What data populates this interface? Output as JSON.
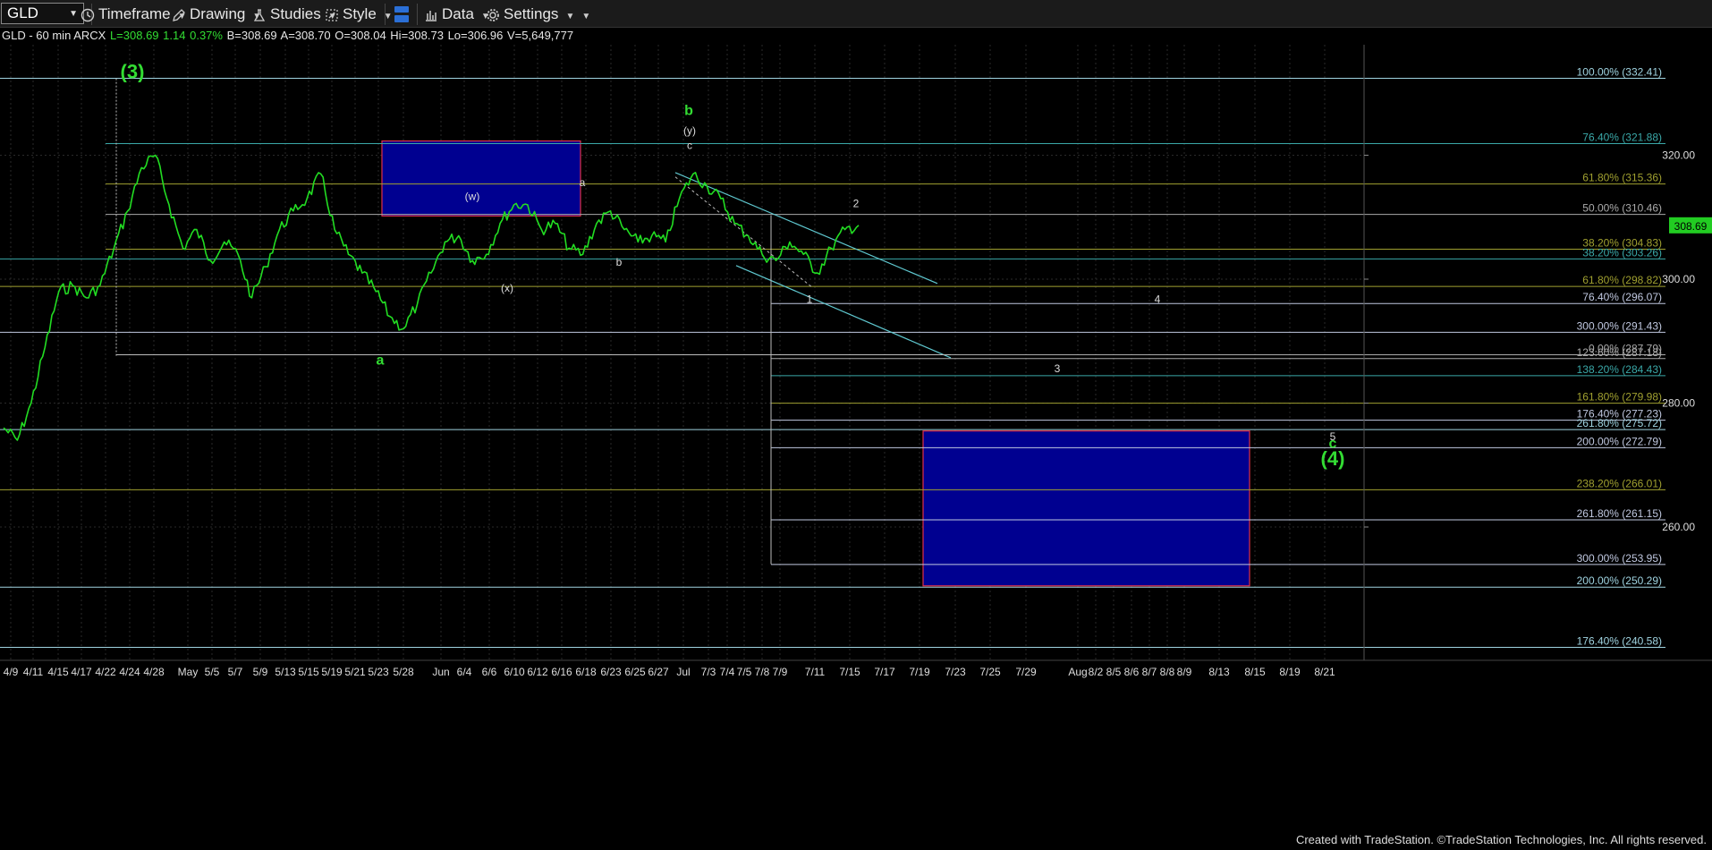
{
  "toolbar": {
    "symbol": "GLD",
    "timeframe": "Timeframe",
    "drawing": "Drawing",
    "studies": "Studies",
    "style": "Style",
    "data": "Data",
    "settings": "Settings"
  },
  "quote": {
    "title": "GLD - 60 min ARCX",
    "last": "L=308.69",
    "change": "1.14",
    "pct": "0.37%",
    "bid": "B=308.69",
    "ask": "A=308.70",
    "open": "O=308.04",
    "high": "Hi=308.73",
    "low": "Lo=306.96",
    "volume": "V=5,649,777"
  },
  "credit": "Created with TradeStation. ©TradeStation Technologies, Inc. All rights reserved.",
  "colors": {
    "background": "#000000",
    "price": "#22dd22",
    "box_fill": "#000090",
    "box_border": "#e0304a",
    "wave_green": "#33dd33",
    "wave_white": "#dddddd",
    "last_price_tag": "#22cc22"
  },
  "chart_data": {
    "type": "line",
    "series": [
      {
        "values": [
          276,
          274,
          280,
          289,
          298,
          299,
          297,
          299,
          305,
          311,
          318,
          320,
          312,
          305,
          308,
          303,
          306,
          304,
          297,
          302,
          308,
          311,
          313,
          317,
          308,
          304,
          301,
          298,
          294,
          292,
          296,
          301,
          306,
          307,
          303,
          304,
          309,
          312,
          312,
          308,
          309,
          305,
          304,
          309,
          311,
          308,
          306,
          307,
          306,
          313,
          317,
          315,
          313,
          309,
          307,
          304,
          303,
          306,
          304,
          301,
          305,
          308,
          308.69
        ]
      }
    ],
    "y_ticks": [
      "320.00",
      "300.00",
      "280.00",
      "260.00"
    ],
    "ylim": [
      237,
      345
    ],
    "x_ticks": [
      "4/9",
      "4/11",
      "4/15",
      "4/17",
      "4/22",
      "4/24",
      "4/28",
      "May",
      "5/5",
      "5/7",
      "5/9",
      "5/13",
      "5/15",
      "5/19",
      "5/21",
      "5/23",
      "5/28",
      "Jun",
      "6/4",
      "6/6",
      "6/10",
      "6/12",
      "6/16",
      "6/18",
      "6/23",
      "6/25",
      "6/27",
      "Jul",
      "7/3",
      "7/4",
      "7/5",
      "7/8",
      "7/9",
      "7/11",
      "7/15",
      "7/17",
      "7/19",
      "7/23",
      "7/25",
      "7/29",
      "Aug",
      "8/2",
      "8/5",
      "8/6",
      "8/7",
      "8/8",
      "8/9",
      "8/13",
      "8/15",
      "8/19",
      "8/21"
    ],
    "last_price": "308.69",
    "fib_levels": [
      {
        "label": "100.00% (332.41)",
        "value": 332.41,
        "color": "#9fd3e0"
      },
      {
        "label": "76.40% (321.88)",
        "value": 321.88,
        "color": "#3aa8a8"
      },
      {
        "label": "61.80% (315.36)",
        "value": 315.36,
        "color": "#a0a030"
      },
      {
        "label": "50.00% (310.46)",
        "value": 310.46,
        "color": "#aaaaaa"
      },
      {
        "label": "38.20% (304.83)",
        "value": 304.83,
        "color": "#a0a030"
      },
      {
        "label": "38.20% (303.26)",
        "value": 303.26,
        "color": "#3aa8a8"
      },
      {
        "label": "61.80% (298.82)",
        "value": 298.82,
        "color": "#a0a030"
      },
      {
        "label": "76.40% (296.07)",
        "value": 296.07,
        "color": "#c0c8e0"
      },
      {
        "label": "300.00% (291.43)",
        "value": 291.43,
        "color": "#c0c8e0"
      },
      {
        "label": "0.00% (287.79)",
        "value": 287.79,
        "color": "#aaaaaa"
      },
      {
        "label": "123.60% (287.18)",
        "value": 287.18,
        "color": "#aaaaaa"
      },
      {
        "label": "138.20% (284.43)",
        "value": 284.43,
        "color": "#3aa8a8"
      },
      {
        "label": "161.80% (279.98)",
        "value": 279.98,
        "color": "#a0a030"
      },
      {
        "label": "176.40% (277.23)",
        "value": 277.23,
        "color": "#c0c8e0"
      },
      {
        "label": "261.80% (275.72)",
        "value": 275.72,
        "color": "#9fd3e0"
      },
      {
        "label": "200.00% (272.79)",
        "value": 272.79,
        "color": "#c0c8e0"
      },
      {
        "label": "238.20% (266.01)",
        "value": 266.01,
        "color": "#a0a030"
      },
      {
        "label": "261.80% (261.15)",
        "value": 261.15,
        "color": "#c0c8e0"
      },
      {
        "label": "300.00% (253.95)",
        "value": 253.95,
        "color": "#c0c8e0"
      },
      {
        "label": "200.00% (250.29)",
        "value": 250.29,
        "color": "#9fd3e0"
      },
      {
        "label": "176.40% (240.58)",
        "value": 240.58,
        "color": "#9fd3e0"
      }
    ],
    "wave_labels": [
      {
        "text": "(3)",
        "color": "green",
        "size": "large",
        "date": "4/22",
        "value": 332.41
      },
      {
        "text": "b",
        "color": "green",
        "size": "medium",
        "date": "6/16",
        "value": 326.5
      },
      {
        "text": "(y)",
        "color": "white",
        "size": "small",
        "date": "6/16",
        "value": 323.4
      },
      {
        "text": "c",
        "color": "white",
        "size": "small",
        "date": "6/16",
        "value": 321
      },
      {
        "text": "(w)",
        "color": "white",
        "size": "small",
        "date": "5/23",
        "value": 312.8
      },
      {
        "text": "a",
        "color": "white",
        "size": "small",
        "date": "6/4",
        "value": 315
      },
      {
        "text": "b",
        "color": "white",
        "size": "small",
        "date": "6/10",
        "value": 302.2
      },
      {
        "text": "(x)",
        "color": "white",
        "size": "small",
        "date": "5/28",
        "value": 298
      },
      {
        "text": "a",
        "color": "green",
        "size": "medium",
        "date": "5/15",
        "value": 286.2
      },
      {
        "text": "2",
        "color": "white",
        "size": "small",
        "date": "Jul",
        "value": 311.6
      },
      {
        "text": "1",
        "color": "white",
        "size": "small",
        "date": "6/27",
        "value": 296.2
      },
      {
        "text": "4",
        "color": "white",
        "size": "small",
        "date": "7/23",
        "value": 296.2
      },
      {
        "text": "3",
        "color": "white",
        "size": "small",
        "date": "7/15",
        "value": 285
      },
      {
        "text": "5",
        "color": "white",
        "size": "small",
        "date": "8/6",
        "value": 274
      },
      {
        "text": "c",
        "color": "green",
        "size": "medium",
        "date": "8/6",
        "value": 272.8
      },
      {
        "text": "(4)",
        "color": "green",
        "size": "large",
        "date": "8/6",
        "value": 270
      }
    ],
    "zones": [
      {
        "from": "5/23",
        "to": "6/18",
        "top": 322.3,
        "bottom": 310.2
      },
      {
        "from": "7/19",
        "to": "8/15",
        "top": 275.5,
        "bottom": 250.5
      }
    ]
  }
}
